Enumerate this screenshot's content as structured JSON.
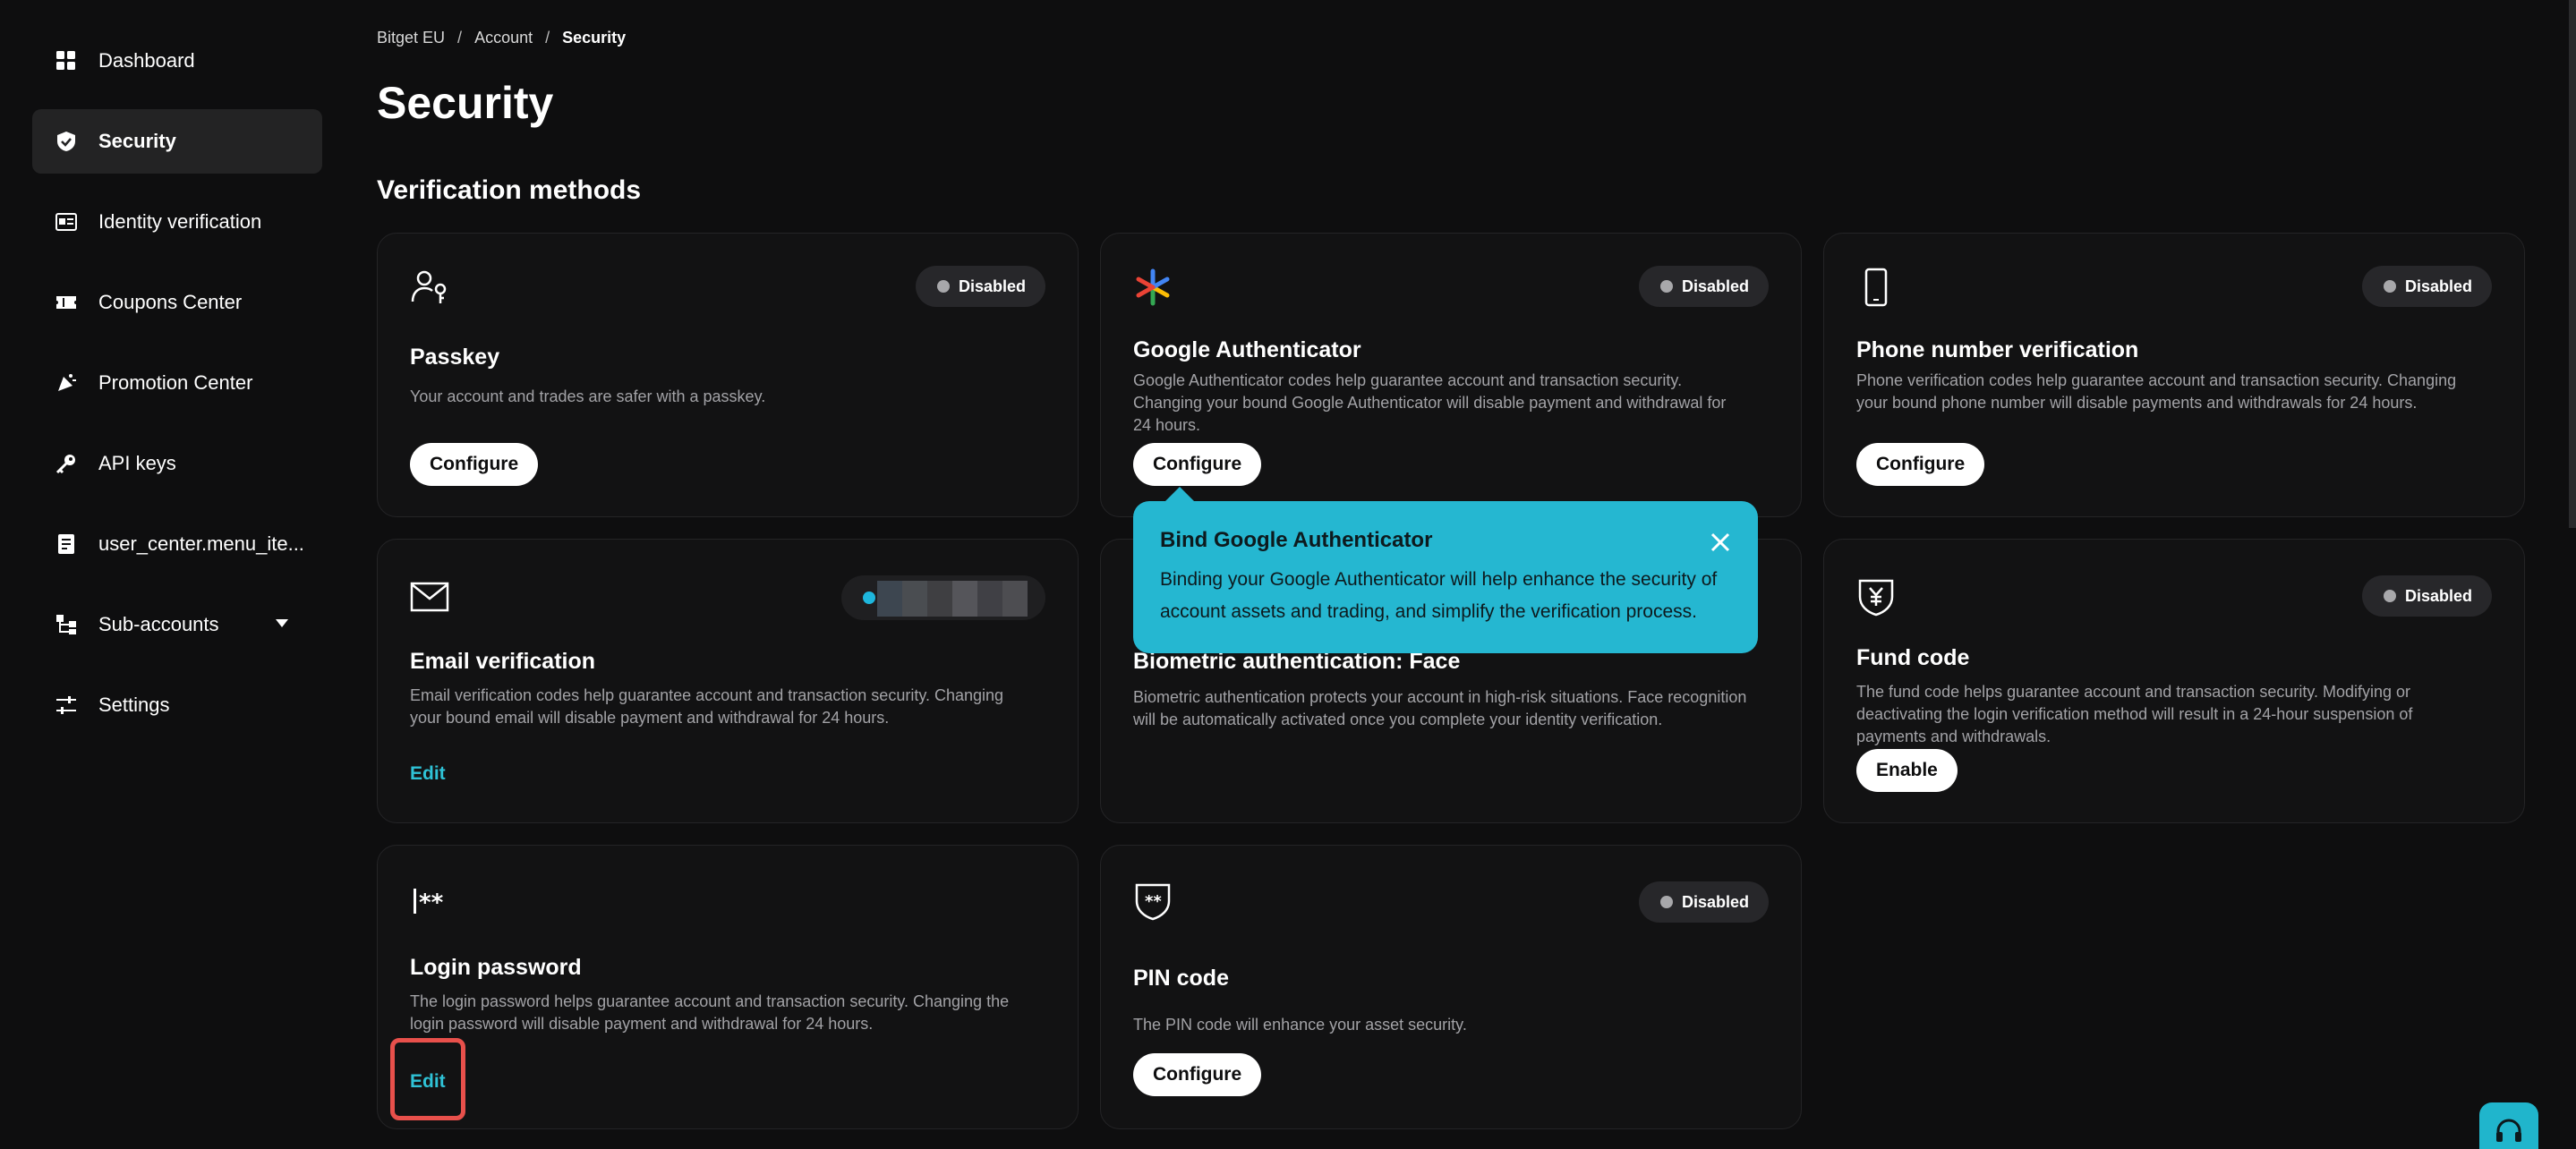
{
  "sidebar": {
    "items": [
      {
        "label": "Dashboard",
        "icon": "grid-icon"
      },
      {
        "label": "Security",
        "icon": "shield-check-icon",
        "active": true
      },
      {
        "label": "Identity verification",
        "icon": "id-card-icon"
      },
      {
        "label": "Coupons Center",
        "icon": "ticket-icon"
      },
      {
        "label": "Promotion Center",
        "icon": "megaphone-icon"
      },
      {
        "label": "API keys",
        "icon": "key-icon"
      },
      {
        "label": "user_center.menu_ite...",
        "icon": "document-icon"
      },
      {
        "label": "Sub-accounts",
        "icon": "hierarchy-icon"
      },
      {
        "label": "Settings",
        "icon": "sliders-icon"
      }
    ]
  },
  "breadcrumb": {
    "items": [
      "Bitget EU",
      "Account",
      "Security"
    ],
    "separator": "/"
  },
  "page_title": "Security",
  "section_title": "Verification methods",
  "cards": {
    "passkey": {
      "title": "Passkey",
      "desc": "Your account and trades are safer with a passkey.",
      "badge": "Disabled",
      "action": "Configure"
    },
    "google": {
      "title": "Google Authenticator",
      "desc": "Google Authenticator codes help guarantee account and transaction security. Changing your bound Google Authenticator will disable payment and withdrawal for 24 hours.",
      "badge": "Disabled",
      "action": "Configure"
    },
    "phone": {
      "title": "Phone number verification",
      "desc": "Phone verification codes help guarantee account and transaction security. Changing your bound phone number will disable payments and withdrawals for 24 hours.",
      "badge": "Disabled",
      "action": "Configure"
    },
    "email": {
      "title": "Email verification",
      "desc": "Email verification codes help guarantee account and transaction security. Changing your bound email will disable payment and withdrawal for 24 hours.",
      "action": "Edit"
    },
    "face": {
      "title": "Biometric authentication: Face",
      "desc": "Biometric authentication protects your account in high-risk situations. Face recognition will be automatically activated once you complete your identity verification."
    },
    "fund": {
      "title": "Fund code",
      "desc": "The fund code helps guarantee account and transaction security. Modifying or deactivating the login verification method will result in a 24-hour suspension of payments and withdrawals.",
      "badge": "Disabled",
      "action": "Enable"
    },
    "login": {
      "title": "Login password",
      "desc": "The login password helps guarantee account and transaction security. Changing the login password will disable payment and withdrawal for 24 hours.",
      "action": "Edit"
    },
    "pin": {
      "title": "PIN code",
      "desc": "The PIN code will enhance your asset security.",
      "badge": "Disabled",
      "action": "Configure"
    }
  },
  "tooltip": {
    "title": "Bind Google Authenticator",
    "body": "Binding your Google Authenticator will help enhance the security of account assets and trading, and simplify the verification process."
  },
  "colors": {
    "accent": "#25b7d1",
    "link": "#2fc2d6",
    "highlight": "#e8504b",
    "background": "#0e0e0f"
  }
}
